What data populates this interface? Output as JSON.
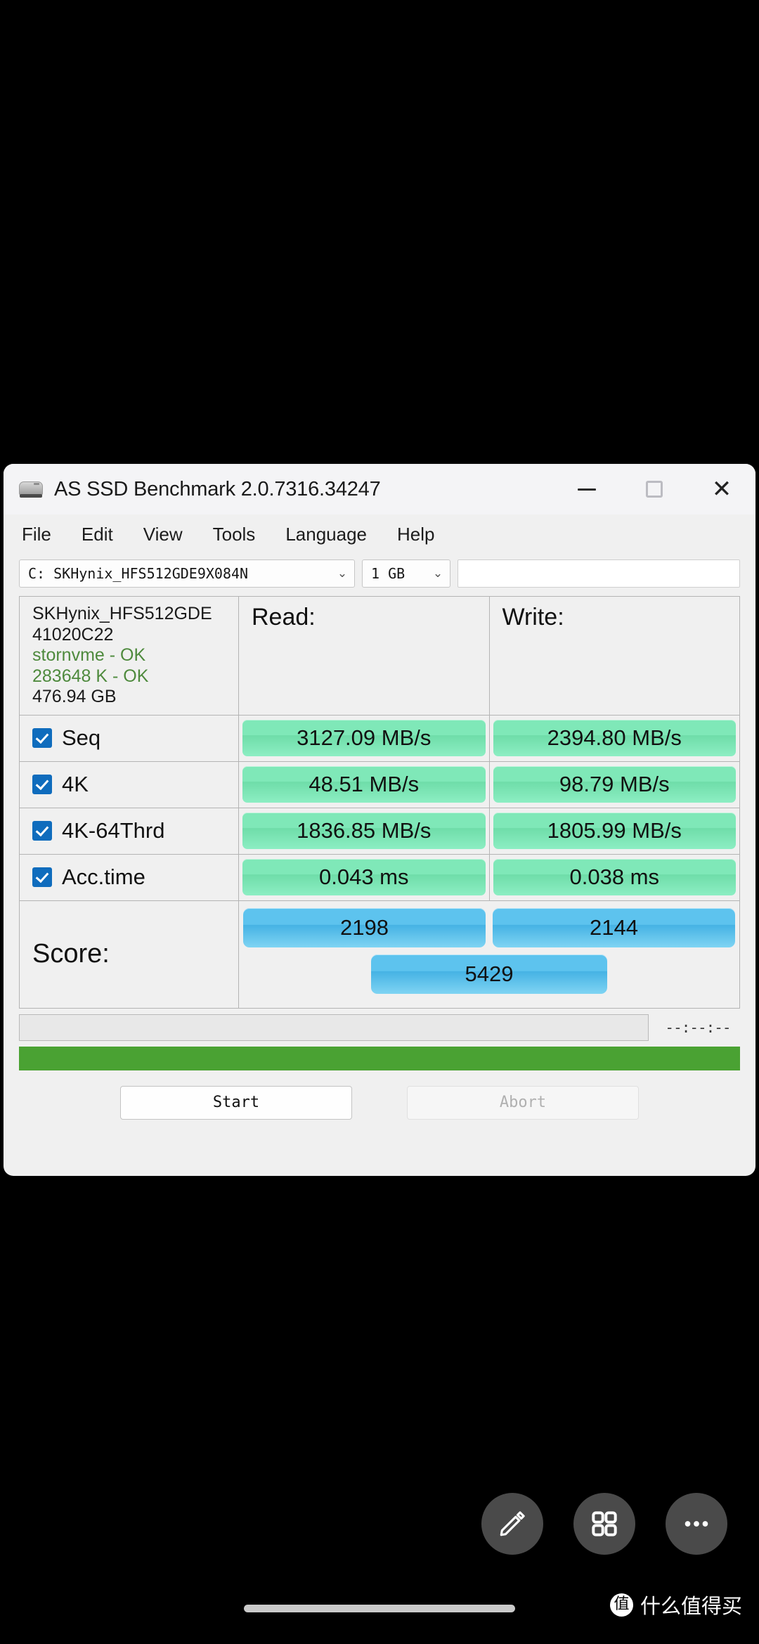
{
  "window": {
    "title": "AS SSD Benchmark 2.0.7316.34247",
    "icon": "hard-drive-icon",
    "controls": {
      "minimize": "—",
      "maximize": "□",
      "close": "✕"
    }
  },
  "menubar": {
    "items": [
      {
        "label": "File"
      },
      {
        "label": "Edit"
      },
      {
        "label": "View"
      },
      {
        "label": "Tools"
      },
      {
        "label": "Language"
      },
      {
        "label": "Help"
      }
    ]
  },
  "toolbar": {
    "drive_select": {
      "value": "C: SKHynix_HFS512GDE9X084N",
      "chevron": "⌄"
    },
    "size_select": {
      "value": "1 GB",
      "chevron": "⌄"
    },
    "blank_field": ""
  },
  "drive_info": {
    "model_line1": "SKHynix_HFS512GDE",
    "model_line2": "41020C22",
    "driver": "stornvme - OK",
    "alignment": "283648 K - OK",
    "capacity": "476.94 GB"
  },
  "columns": {
    "read": "Read:",
    "write": "Write:"
  },
  "results": [
    {
      "name": "Seq",
      "checked": true,
      "read": "3127.09 MB/s",
      "write": "2394.80 MB/s"
    },
    {
      "name": "4K",
      "checked": true,
      "read": "48.51 MB/s",
      "write": "98.79 MB/s"
    },
    {
      "name": "4K-64Thrd",
      "checked": true,
      "read": "1836.85 MB/s",
      "write": "1805.99 MB/s"
    },
    {
      "name": "Acc.time",
      "checked": true,
      "read": "0.043 ms",
      "write": "0.038 ms"
    }
  ],
  "score": {
    "label": "Score:",
    "read": "2198",
    "write": "2144",
    "total": "5429"
  },
  "status": {
    "message": "",
    "timer": "--:--:--",
    "progress_percent": 100
  },
  "buttons": {
    "start": "Start",
    "abort": "Abort"
  },
  "fabs": [
    {
      "name": "edit-fab",
      "icon": "pencil-icon"
    },
    {
      "name": "apps-fab",
      "icon": "grid-icon"
    },
    {
      "name": "more-fab",
      "icon": "ellipsis-icon"
    }
  ],
  "watermark": {
    "logo_char": "值",
    "text": "什么值得买"
  },
  "colors": {
    "accent_blue": "#0f6cbd",
    "result_green": "#7fe8b8",
    "score_blue": "#5dc3ee",
    "progress_green": "#4aa233",
    "ok_text": "#4e8a3d",
    "window_bg": "#f0f0f0",
    "screen_bg": "#000000"
  }
}
